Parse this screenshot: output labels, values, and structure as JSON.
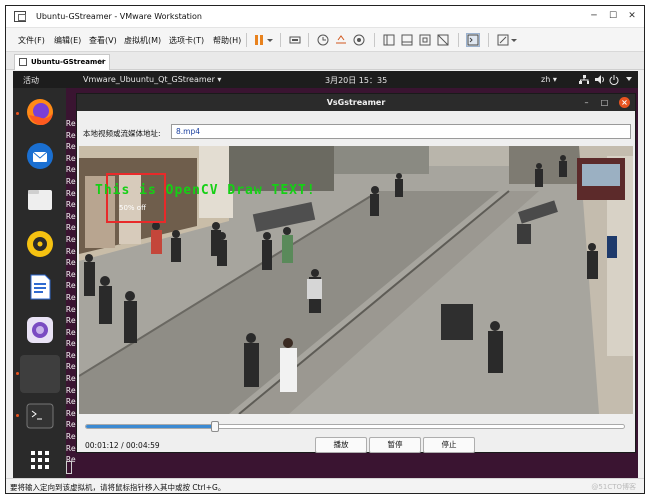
{
  "vmware": {
    "title": "Ubuntu-GStreamer - VMware Workstation",
    "menu": [
      "文件(F)",
      "编辑(E)",
      "查看(V)",
      "虚拟机(M)",
      "选项卡(T)",
      "帮助(H)"
    ],
    "tab_label": "Ubuntu-GStreamer",
    "status_text": "要将输入定向到该虚拟机，请将鼠标指针移入其中或按 Ctrl+G。",
    "watermark": "@51CTO博客"
  },
  "ubuntu": {
    "activities": "活动",
    "app_menu": "Vmware_Ubuuntu_Qt_GStreamer ▾",
    "clock": "3月20日  15：35",
    "lang": "zh ▾",
    "term_prefix": "Re"
  },
  "app": {
    "title": "VsGstreamer",
    "url_label": "本地视频或流媒体地址:",
    "url_value": "8.mp4",
    "overlay_text": "This is OpenCV Draw TEXT!",
    "sign_text": "50% off",
    "progress": 0.24,
    "time": "00:01:12 / 00:04:59",
    "buttons": {
      "play": "播放",
      "pause": "暂停",
      "stop": "停止"
    }
  },
  "colors": {
    "overlay_text": "#15d015",
    "detect_box": "#e82a2a",
    "ubuntu_orange": "#e95420",
    "seek_fill": "#3c8ad2"
  }
}
